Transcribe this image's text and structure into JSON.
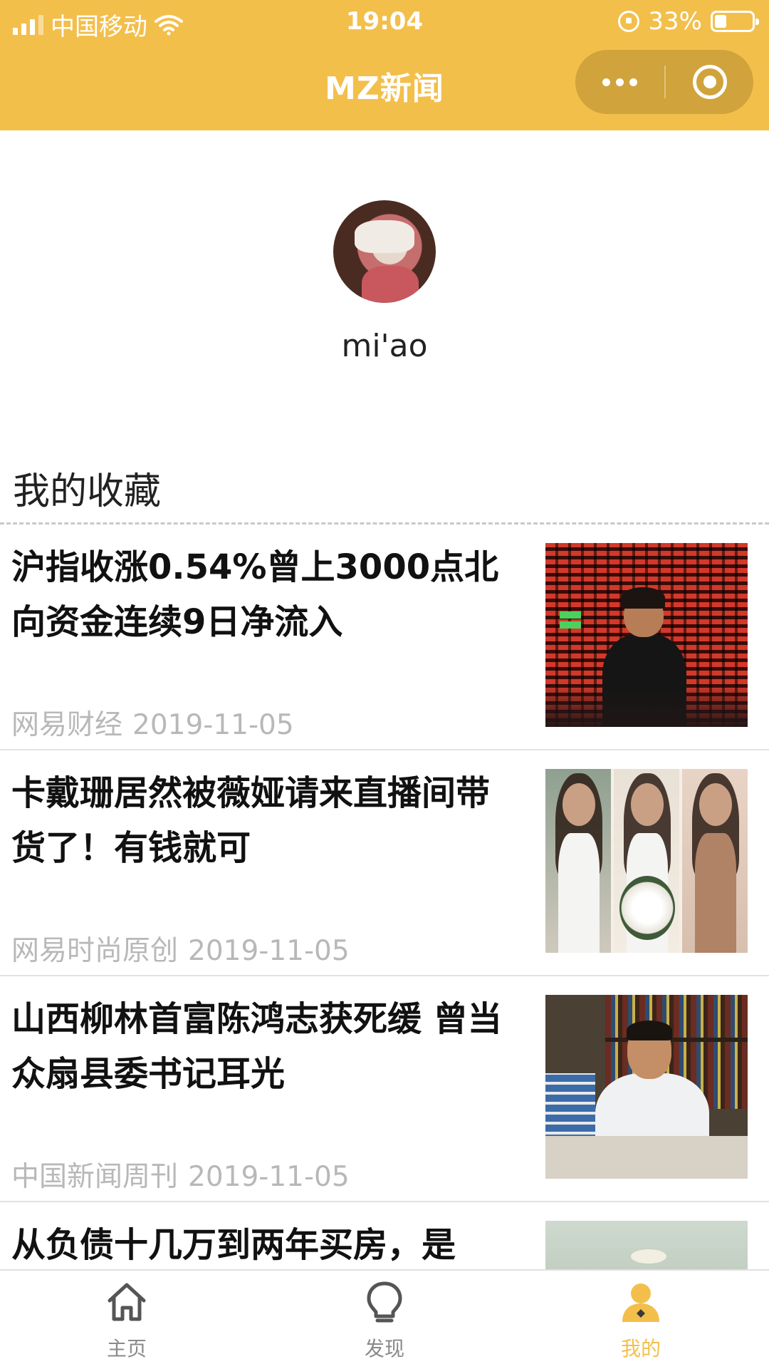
{
  "status_bar": {
    "carrier": "中国移动",
    "time": "19:04",
    "battery": "33%"
  },
  "nav": {
    "title": "MZ新闻"
  },
  "profile": {
    "username": "mi'ao"
  },
  "favorites": {
    "title": "我的收藏",
    "items": [
      {
        "title": "沪指收涨0.54%曾上3000点北向资金连续9日净流入",
        "source": "网易财经",
        "date": "2019-11-05",
        "thumb_icon": "stock-market-photo"
      },
      {
        "title": "卡戴珊居然被薇娅请来直播间带货了！有钱就可",
        "source": "网易时尚原创",
        "date": "2019-11-05",
        "thumb_icon": "fashion-photo"
      },
      {
        "title": "山西柳林首富陈鸿志获死缓 曾当众扇县委书记耳光",
        "source": "中国新闻周刊",
        "date": "2019-11-05",
        "thumb_icon": "office-photo"
      },
      {
        "title": "从负债十几万到两年买房，是",
        "source": "",
        "date": "",
        "thumb_icon": "outdoor-photo"
      }
    ]
  },
  "tabbar": {
    "items": [
      {
        "label": "主页",
        "icon": "home-icon"
      },
      {
        "label": "发现",
        "icon": "lightbulb-icon"
      },
      {
        "label": "我的",
        "icon": "user-icon"
      }
    ],
    "active_index": 2
  },
  "colors": {
    "brand": "#f3bf4b",
    "meta_text": "#b8b8b8"
  }
}
